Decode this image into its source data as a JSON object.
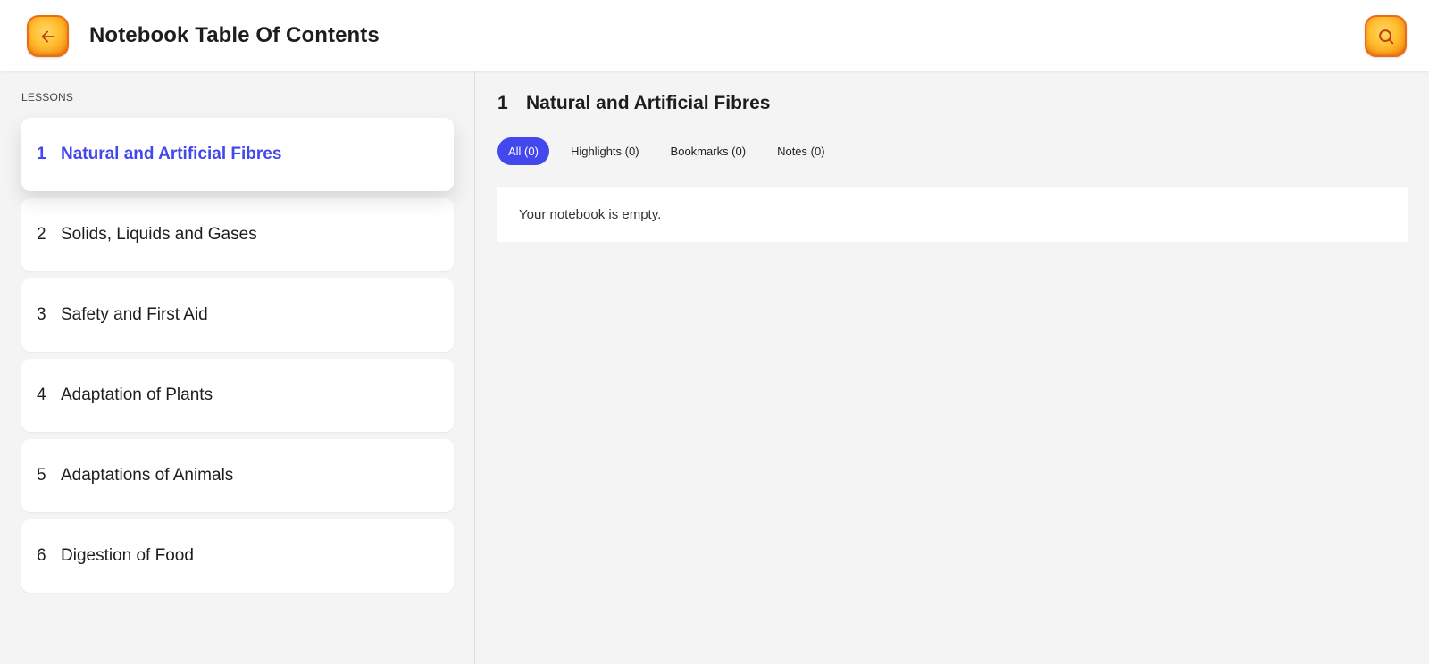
{
  "header": {
    "title": "Notebook Table Of Contents",
    "back_icon": "arrow-left-icon",
    "search_icon": "search-icon",
    "accent_color": "#ffbe2e"
  },
  "sidebar": {
    "section_label": "LESSONS",
    "lessons": [
      {
        "number": "1",
        "title": "Natural and Artificial Fibres",
        "active": true
      },
      {
        "number": "2",
        "title": "Solids, Liquids and Gases",
        "active": false
      },
      {
        "number": "3",
        "title": "Safety and First Aid",
        "active": false
      },
      {
        "number": "4",
        "title": "Adaptation of Plants",
        "active": false
      },
      {
        "number": "5",
        "title": "Adaptations of Animals",
        "active": false
      },
      {
        "number": "6",
        "title": "Digestion of Food",
        "active": false
      }
    ],
    "active_color": "#4347ee"
  },
  "main": {
    "lesson_number": "1",
    "lesson_title": "Natural and Artificial Fibres",
    "tabs": [
      {
        "label": "All (0)",
        "active": true
      },
      {
        "label": "Highlights (0)",
        "active": false
      },
      {
        "label": "Bookmarks (0)",
        "active": false
      },
      {
        "label": "Notes (0)",
        "active": false
      }
    ],
    "empty_message": "Your notebook is empty."
  }
}
